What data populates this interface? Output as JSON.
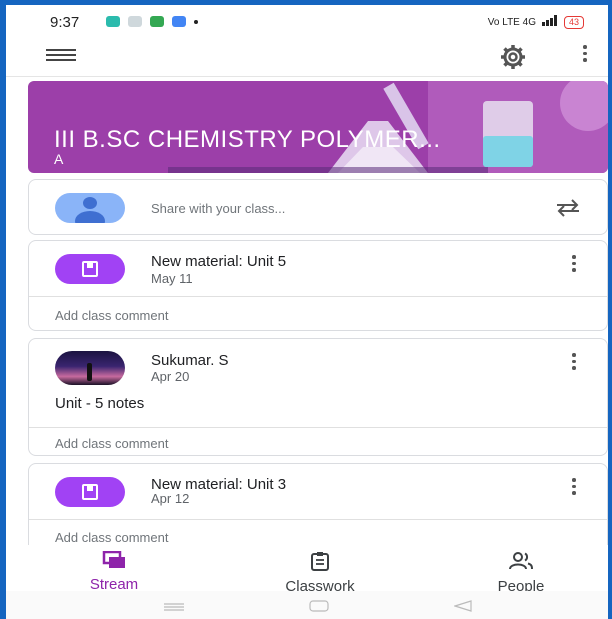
{
  "status_bar": {
    "time": "9:37",
    "network": "Vo LTE 4G",
    "battery": "43"
  },
  "banner": {
    "title": "III B.SC CHEMISTRY POLYMER...",
    "subtitle": "A"
  },
  "share": {
    "placeholder": "Share with your class..."
  },
  "posts": [
    {
      "title": "New material: Unit 5",
      "date": "May 11",
      "comment_label": "Add class comment"
    },
    {
      "author": "Sukumar. S",
      "date": "Apr 20",
      "body": "Unit - 5 notes",
      "comment_label": "Add class comment"
    },
    {
      "title": "New material: Unit 3",
      "date": "Apr 12",
      "comment_label": "Add class comment"
    }
  ],
  "bottom_nav": {
    "stream": "Stream",
    "classwork": "Classwork",
    "people": "People"
  },
  "colors": {
    "accent": "#8e24aa",
    "banner": "#9c3fa9",
    "material_icon": "#a142f4",
    "frame": "#1565c0"
  },
  "icons": [
    "menu-icon",
    "settings-gear-icon",
    "more-vert-icon",
    "repost-icon",
    "material-icon",
    "stream-icon",
    "classwork-icon",
    "people-icon"
  ]
}
